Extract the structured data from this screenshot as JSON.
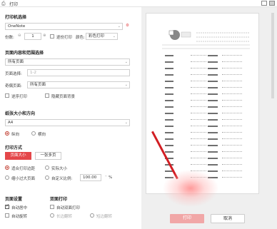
{
  "window": {
    "title": "打印",
    "app_icon": "printer-icon"
  },
  "printer": {
    "section": "打印机选择",
    "selected": "OneNote"
  },
  "copies": {
    "label": "份数:",
    "value": "1",
    "collate_label": "逐份打印",
    "color_label": "颜色:",
    "color_value": "彩色打印"
  },
  "content": {
    "section": "页面内容和范围选择",
    "range_value": "所有页面",
    "page_select_label": "页面选择:",
    "page_select_placeholder": "1-2",
    "odd_even_label": "奇偶页面:",
    "odd_even_value": "所有页面",
    "reverse_label": "逆序打印",
    "hide_bg_label": "隐藏页面背景"
  },
  "paper": {
    "section": "纸张大小和方向",
    "size_value": "A4",
    "portrait_label": "纵向",
    "landscape_label": "横向"
  },
  "print_mode": {
    "section": "打印方式",
    "tab_page_size": "页面大小",
    "tab_multi": "一张多页",
    "fit_label": "适合打印边距",
    "actual_label": "实际大小",
    "shrink_label": "缩小过大页面",
    "custom_label": "自定义比例:",
    "custom_value": "100.00",
    "percent": "%"
  },
  "page_settings": {
    "section": "页面设置",
    "auto_center": "自动居中",
    "auto_rotate": "自动旋转"
  },
  "duplex": {
    "section": "双面打印",
    "auto_flip": "自动双面打印",
    "long_edge": "长边翻转",
    "short_edge": "短边翻转"
  },
  "actions": {
    "print": "打印",
    "cancel": "取消"
  },
  "colors": {
    "accent": "#e4474a",
    "arrow": "#d21e23"
  }
}
